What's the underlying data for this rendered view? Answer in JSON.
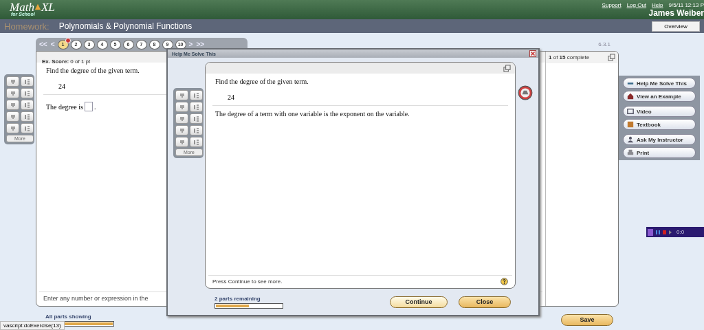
{
  "header": {
    "logo": {
      "word": "Math",
      "mark": "XL",
      "sub": "for School"
    },
    "links": [
      "Support",
      "Log Out",
      "Help"
    ],
    "datetime": "9/5/11 12:13 P",
    "user": "James Weiber"
  },
  "title_bar": {
    "label": "Homework:",
    "title": "Polynomials & Polynomial Functions",
    "overview_button": "Overview"
  },
  "question_nav": {
    "first": "<<",
    "prev": "<",
    "next": ">",
    "last": ">>",
    "items": [
      {
        "label": "1",
        "selected": true,
        "error": true
      },
      {
        "label": "2",
        "selected": false,
        "error": false
      },
      {
        "label": "3",
        "selected": false,
        "error": false
      },
      {
        "label": "4",
        "selected": false,
        "error": false
      },
      {
        "label": "5",
        "selected": false,
        "error": false
      },
      {
        "label": "6",
        "selected": false,
        "error": false
      },
      {
        "label": "7",
        "selected": false,
        "error": false
      },
      {
        "label": "8",
        "selected": false,
        "error": false
      },
      {
        "label": "9",
        "selected": false,
        "error": false
      },
      {
        "label": "10",
        "selected": false,
        "error": false
      }
    ]
  },
  "section": "6.3.1",
  "exercise": {
    "score": "**Ex. Score:** 0 of 1 pt",
    "prompt": "Find the degree of the given term.",
    "term": "24",
    "answer_prefix": "The degree is",
    "answer_suffix": ".",
    "hint": "Enter any number or expression in the"
  },
  "progress_pane": {
    "label": "**1** of **15** complete"
  },
  "palette": {
    "more": "More"
  },
  "tool_groups": [
    [
      "Help Me Solve This",
      "View an Example"
    ],
    [
      "Video",
      "Textbook"
    ],
    [
      "Ask My Instructor",
      "Print"
    ]
  ],
  "bottom": {
    "parts_label": "All parts showing",
    "level": 1,
    "save": "Save"
  },
  "media_player": {
    "time": "0:0"
  },
  "status_bar": "vascript:doExercise(13)",
  "dialog": {
    "title": "Help Me Solve This",
    "prompt": "Find the degree of the given term.",
    "term": "24",
    "explanation": "The degree of a term with one variable is the exponent on the variable.",
    "footer": "Press Continue to see more.",
    "parts_label": "2 parts remaining",
    "level": 0.5,
    "continue": "Continue",
    "close": "Close",
    "palette_more": "More"
  }
}
